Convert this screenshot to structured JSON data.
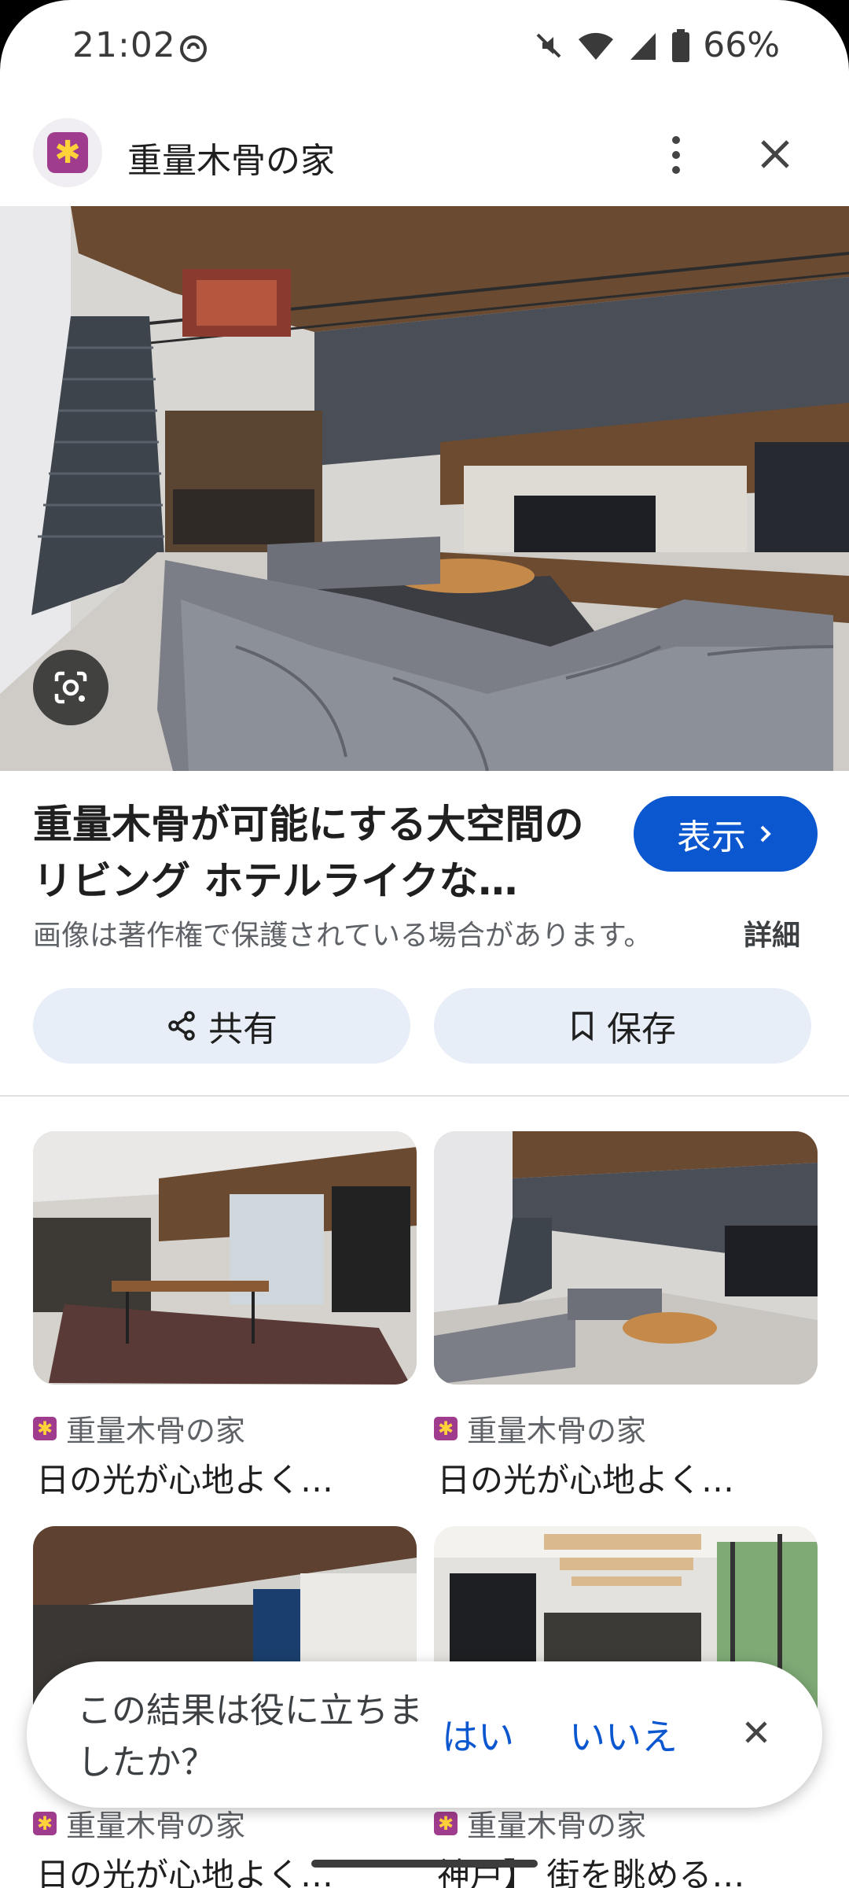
{
  "status": {
    "time": "21:02",
    "battery": "66%"
  },
  "header": {
    "site_name": "重量木骨の家"
  },
  "result": {
    "title": "重量木骨が可能にする大空間のリビング ホテルライクな…",
    "visit_label": "表示",
    "copyright": "画像は著作権で保護されている場合があります。",
    "details_label": "詳細"
  },
  "actions": {
    "share_label": "共有",
    "save_label": "保存"
  },
  "related": [
    {
      "source": "重量木骨の家",
      "title": "日の光が心地よく…"
    },
    {
      "source": "重量木骨の家",
      "title": "日の光が心地よく…"
    },
    {
      "source": "重量木骨の家",
      "title": "日の光が心地よく…"
    },
    {
      "source": "重量木骨の家",
      "title": "神戸】 街を眺める…"
    }
  ],
  "feedback": {
    "question": "この結果は役に立ちましたか？",
    "yes": "はい",
    "no": "いいえ"
  },
  "colors": {
    "accent": "#0b57d0",
    "chip_bg": "#e8eef8",
    "favicon": "#a03c8e"
  }
}
